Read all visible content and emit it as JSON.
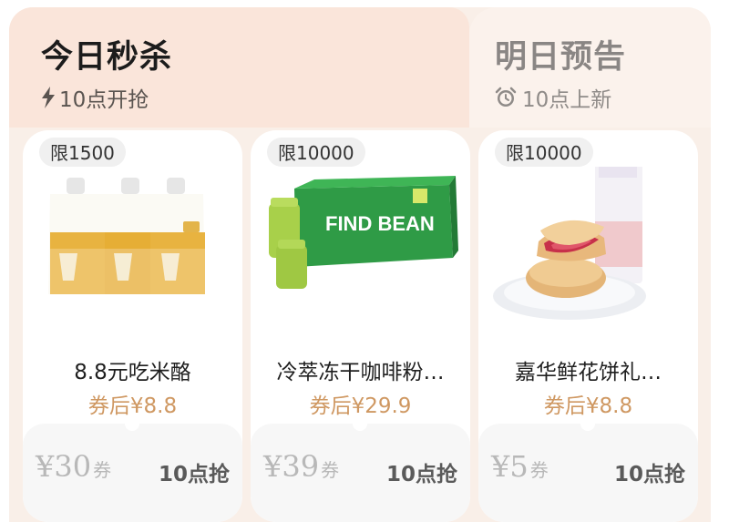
{
  "tabs": [
    {
      "title": "今日秒杀",
      "subtitle": "10点开抢",
      "icon": "lightning-icon",
      "active": true
    },
    {
      "title": "明日预告",
      "subtitle": "10点上新",
      "icon": "alarm-clock-icon",
      "active": false
    }
  ],
  "products": [
    {
      "limit": "限1500",
      "name": "8.8元吃米酪",
      "price_after": "券后¥8.8",
      "coupon_amount": "¥30",
      "coupon_unit": "券",
      "button": "10点抢",
      "image": "rice-yogurt-pouches"
    },
    {
      "limit": "限10000",
      "name": "冷萃冻干咖啡粉…",
      "price_after": "券后¥29.9",
      "coupon_amount": "¥39",
      "coupon_unit": "券",
      "button": "10点抢",
      "image": "coffee-box",
      "image_text": "FIND BEAN"
    },
    {
      "limit": "限10000",
      "name": "嘉华鲜花饼礼…",
      "price_after": "券后¥8.8",
      "coupon_amount": "¥5",
      "coupon_unit": "券",
      "button": "10点抢",
      "image": "flower-cake"
    }
  ],
  "colors": {
    "accent_price": "#cf9862",
    "tab_active_bg": "#fae5da",
    "card_bg": "#ffffff"
  }
}
